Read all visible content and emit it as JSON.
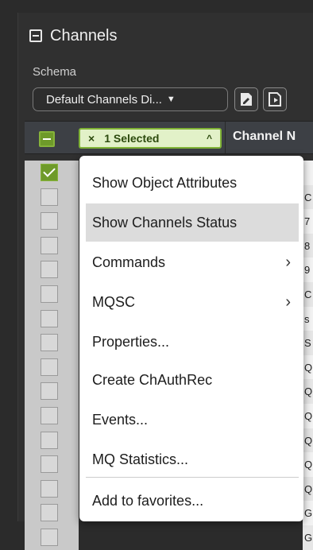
{
  "panel": {
    "title": "Channels",
    "schema_label": "Schema",
    "schema_value": "Default Channels Di...",
    "schema_caret": "▼"
  },
  "toolbar": {
    "icons": [
      "edit-schema-icon",
      "new-schema-icon"
    ]
  },
  "table": {
    "selection_chip": {
      "close": "×",
      "text": "1 Selected",
      "caret": "^"
    },
    "column_header": "Channel N",
    "rows": [
      {
        "checked": true,
        "cell": ""
      },
      {
        "checked": false,
        "cell": "C"
      },
      {
        "checked": false,
        "cell": "7"
      },
      {
        "checked": false,
        "cell": "8"
      },
      {
        "checked": false,
        "cell": "9"
      },
      {
        "checked": false,
        "cell": "C"
      },
      {
        "checked": false,
        "cell": "s"
      },
      {
        "checked": false,
        "cell": "S"
      },
      {
        "checked": false,
        "cell": "Q"
      },
      {
        "checked": false,
        "cell": "Q"
      },
      {
        "checked": false,
        "cell": "Q"
      },
      {
        "checked": false,
        "cell": "Q"
      },
      {
        "checked": false,
        "cell": "Q"
      },
      {
        "checked": false,
        "cell": "Q"
      },
      {
        "checked": false,
        "cell": "G"
      },
      {
        "checked": false,
        "cell": "G"
      }
    ]
  },
  "context_menu": {
    "items": [
      {
        "label": "Show Object Attributes",
        "submenu": false
      },
      {
        "label": "Show Channels Status",
        "submenu": false,
        "hovered": true
      },
      {
        "label": "Commands",
        "submenu": true
      },
      {
        "label": "MQSC",
        "submenu": true
      },
      {
        "label": "Properties...",
        "submenu": false
      },
      {
        "label": "Create ChAuthRec",
        "submenu": false
      },
      {
        "label": "Events...",
        "submenu": false
      },
      {
        "label": "MQ Statistics...",
        "submenu": false
      },
      {
        "label": "Add to favorites...",
        "submenu": false
      }
    ],
    "submenu_glyph": "›"
  },
  "colors": {
    "accent_green": "#6e9a2a",
    "chip_bg": "#e2f1c8",
    "menu_hover": "#dcdcdc",
    "panel_bg": "#303030"
  }
}
